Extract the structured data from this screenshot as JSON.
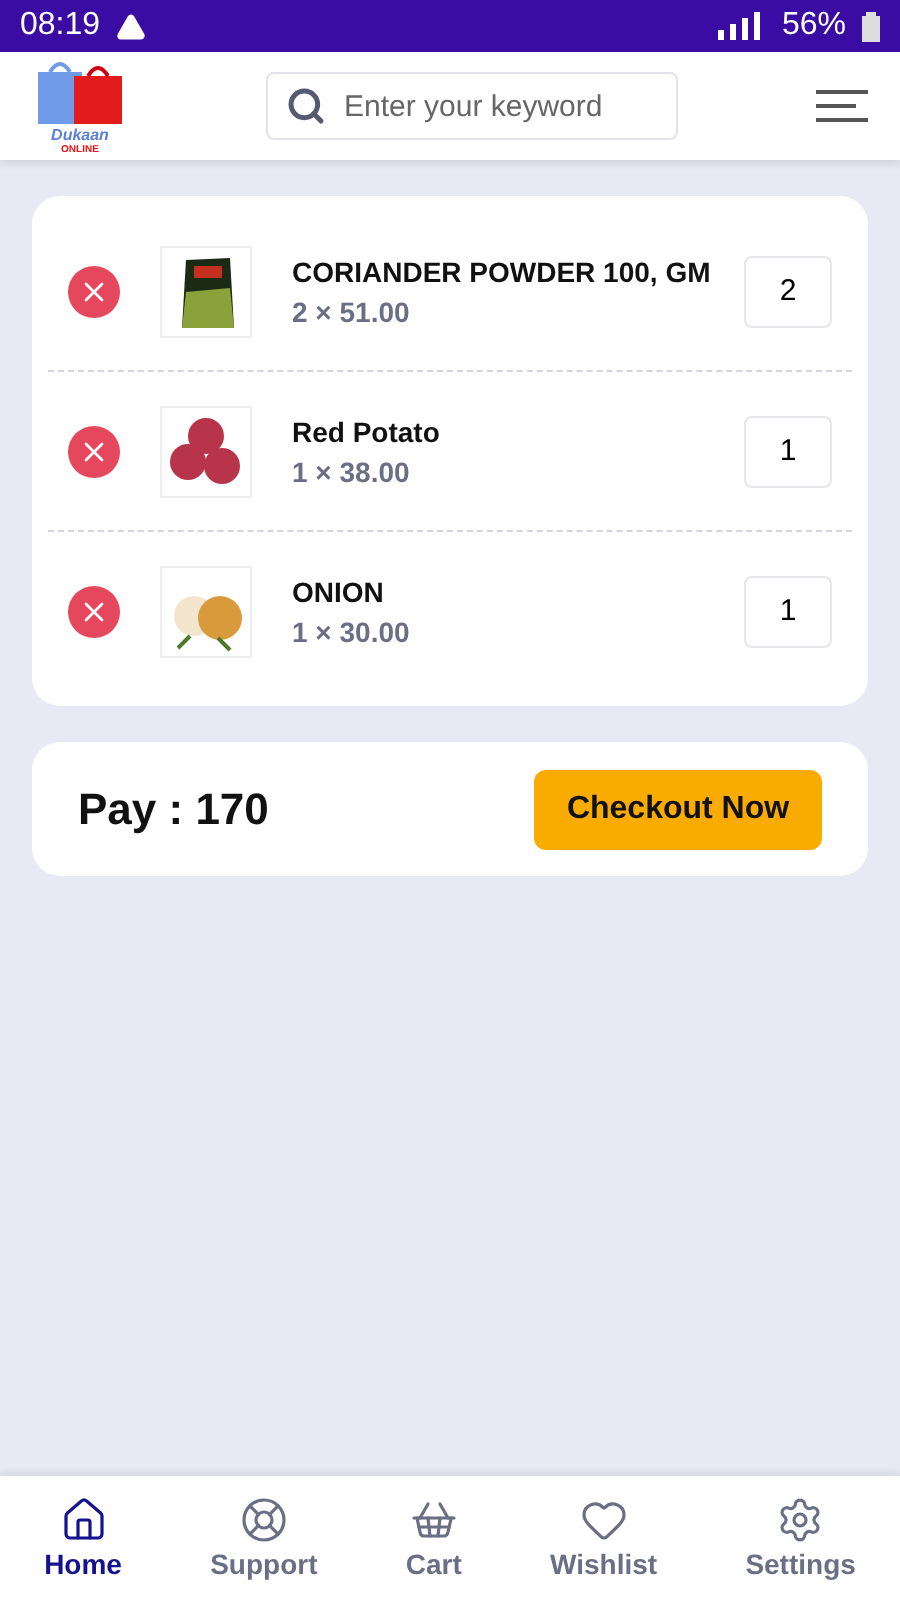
{
  "status_bar": {
    "time": "08:19",
    "battery": "56%"
  },
  "header": {
    "logo": {
      "word": "Dukaan",
      "tag": "ONLINE"
    },
    "search": {
      "placeholder": "Enter your keyword"
    }
  },
  "cart_items": [
    {
      "name": "CORIANDER POWDER 100, GM",
      "price": "2 × 51.00",
      "quantity": "2",
      "kind": "packet"
    },
    {
      "name": "Red Potato",
      "price": "1 × 38.00",
      "quantity": "1",
      "kind": "potato"
    },
    {
      "name": "ONION",
      "price": "1 × 30.00",
      "quantity": "1",
      "kind": "onion"
    }
  ],
  "total": {
    "label": "Pay : 170",
    "button": "Checkout Now"
  },
  "nav": [
    {
      "label": "Home",
      "selected": true
    },
    {
      "label": "Support",
      "selected": false
    },
    {
      "label": "Cart",
      "selected": false
    },
    {
      "label": "Wishlist",
      "selected": false
    },
    {
      "label": "Settings",
      "selected": false
    }
  ]
}
